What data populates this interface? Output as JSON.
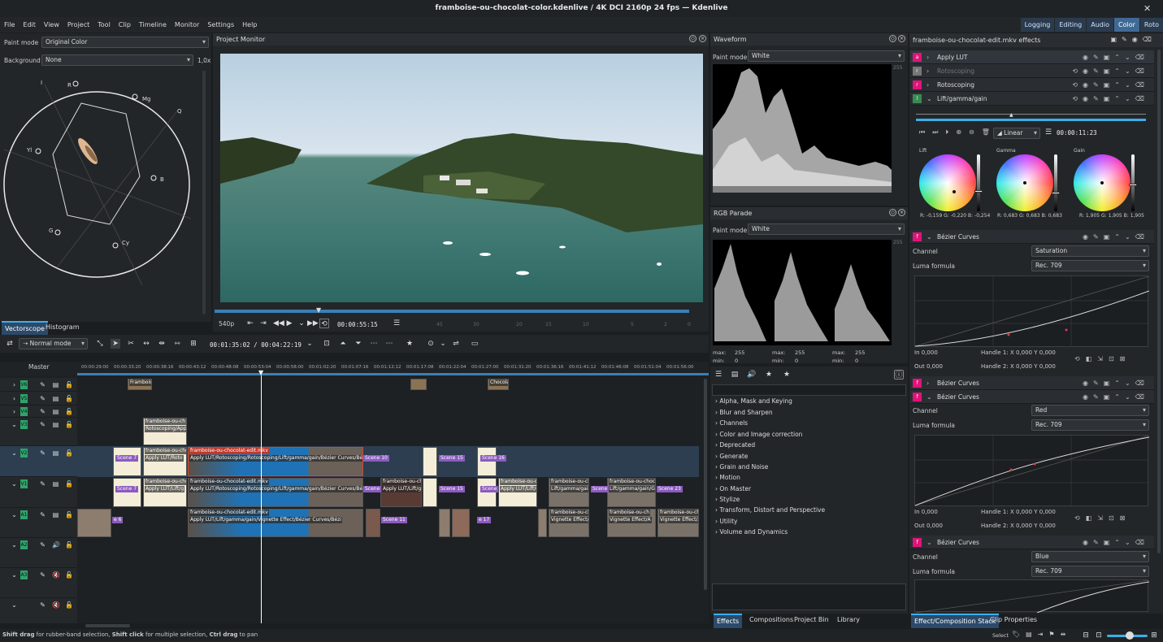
{
  "window": {
    "title": "framboise-ou-chocolat-color.kdenlive / 4K DCI 2160p 24 fps — Kdenlive",
    "close": "✕"
  },
  "menu": [
    "File",
    "Edit",
    "View",
    "Project",
    "Tool",
    "Clip",
    "Timeline",
    "Monitor",
    "Settings",
    "Help"
  ],
  "workspaces": [
    "Logging",
    "Editing",
    "Audio",
    "Color",
    "Roto"
  ],
  "vectorscope": {
    "paint_mode_label": "Paint mode",
    "paint_mode_value": "Original Color",
    "background_label": "Background",
    "background_value": "None",
    "zoom": "1,0x",
    "labels": {
      "r": "R",
      "mg": "Mg",
      "b": "B",
      "cy": "Cy",
      "g": "G",
      "yl": "Yl",
      "i": "I",
      "q": "Q"
    },
    "tabs": [
      "Vectorscope",
      "Histogram"
    ]
  },
  "project_monitor": {
    "title": "Project Monitor",
    "resolution": "540p",
    "timecode": "00:00:55:15",
    "ruler": [
      "45",
      "30",
      "20",
      "15",
      "10",
      "5",
      "2",
      "0"
    ]
  },
  "waveform": {
    "title": "Waveform",
    "paint_mode_label": "Paint mode",
    "paint_mode_value": "White",
    "top_value": "255"
  },
  "rgb_parade": {
    "title": "RGB Parade",
    "paint_mode_label": "Paint mode",
    "paint_mode_value": "White",
    "top_value": "255",
    "max_label": "max:",
    "min_label": "min:",
    "max_value": "255",
    "min_value": "0"
  },
  "timeline": {
    "mode": "Normal mode",
    "position": "00:01:35:02",
    "duration": "00:04:22:19",
    "master": "Master",
    "ruler": [
      "00:00:29:00",
      "00:00:33:20",
      "00:00:38:16",
      "00:00:43:12",
      "00:00:48:08",
      "00:00:53:04",
      "00:00:58:00",
      "00:01:02:20",
      "00:01:07:16",
      "00:01:12:12",
      "00:01:17:08",
      "00:01:22:04",
      "00:01:27:00",
      "00:01:31:20",
      "00:01:36:16",
      "00:01:41:12",
      "00:01:46:08",
      "00:01:51:04",
      "00:01:56:00"
    ],
    "tracks": [
      "V6",
      "V5",
      "V4",
      "V3",
      "V2",
      "V1",
      "A1",
      "A2",
      "A3"
    ],
    "clips": {
      "fr": "Framboise",
      "ch": "Chocolat",
      "v3a": "framboise-ou-ch",
      "v3b": "Rotoscoping/Appl",
      "v2a": "framboise-ou-chocolat-edit.mkv",
      "v2b": "Apply LUT/Roto",
      "v2c": "Apply LUT/Rotoscoping/Rotoscoping/Lift/gamma/gain/Bézier Curves/Bézi",
      "v1a": "framboise-ou-chocolat-edit.mkv",
      "v1b": "Apply LUT/Lift/g",
      "v1c": "Apply LUT/Rotoscoping/Rotoscoping/Lift/gamma/gain/Bézier Curves/Bézi",
      "v1d": "framboise-ou-chocolat",
      "v1e": "Apply LUT/Lift/g",
      "v1f": "framboise-ou-chocol",
      "v1g": "Apply LUT/Lift/g",
      "v1h": "framboise-ou-choco",
      "v1i": "Lift/gamma/gain",
      "v1j": "framboise-ou-choco",
      "v1k": "Lift/gamma/gain/Gri",
      "a1a": "framboise-ou-chocolat-edit.mkv",
      "a1b": "Apply LUT/Lift/gamma/gain/Vignette Effect/Bézier Curves/Bézi",
      "a1c": "framboise-ou-cho",
      "a1d": "Vignette Effect/A",
      "a1e": "framboise-ou-ch",
      "a1f": "Vignette Effect/A",
      "a1g": "framboise-ou-ch",
      "a1h": "Vignette Effect/A",
      "r1": "Roto",
      "scene": "Scenes"
    },
    "markers": {
      "s7": "Scene 7",
      "s10": "Scene 10",
      "s15": "Scene 15",
      "s16": "Scene 16",
      "s23": "Scene 23",
      "s6": "e 6",
      "s11": "Scene 11",
      "s17": "e 17",
      "sc": "Scene"
    }
  },
  "effects_stack": {
    "title": "framboise-ou-chocolat-edit.mkv effects",
    "items": [
      {
        "name": "Apply LUT",
        "color": "#e0147a",
        "letter": "a"
      },
      {
        "name": "Rotoscoping",
        "color": "#777777",
        "letter": "r"
      },
      {
        "name": "Rotoscoping",
        "color": "#e0147a",
        "letter": "r"
      },
      {
        "name": "Lift/gamma/gain",
        "color": "#3a8a54",
        "letter": "l"
      }
    ],
    "interp": "Linear",
    "kf_time": "00:00:11:23",
    "lgg": {
      "lift": "Lift",
      "gamma": "Gamma",
      "gain": "Gain",
      "lift_vals": "R: -0,159   G: -0,220   B: -0,254",
      "gamma_vals": "R: 0,683   G: 0,683   B: 0,683",
      "gain_vals": "R: 1,905   G: 1,905   B: 1,905"
    },
    "bezier": "Bézier Curves",
    "channel_label": "Channel",
    "luma_label": "Luma formula",
    "luma_value": "Rec. 709",
    "ch1": "Saturation",
    "ch2": "Red",
    "ch3": "Blue",
    "in_label": "In",
    "out_label": "Out",
    "zero": "0,000",
    "h1": "Handle 1:",
    "h2": "Handle 2:",
    "x": "X",
    "y": "Y"
  },
  "effects_panel": {
    "categories": [
      "Alpha, Mask and Keying",
      "Blur and Sharpen",
      "Channels",
      "Color and Image correction",
      "Deprecated",
      "Generate",
      "Grain and Noise",
      "Motion",
      "On Master",
      "Stylize",
      "Transform, Distort and Perspective",
      "Utility",
      "Volume and Dynamics"
    ],
    "tabs": [
      "Effects",
      "Compositions",
      "Project Bin",
      "Library"
    ]
  },
  "right_tabs": [
    "Effect/Composition Stack",
    "Clip Properties"
  ],
  "status": {
    "text1": "Shift drag",
    "text2": " for rubber-band selection, ",
    "text3": "Shift click",
    "text4": " for multiple selection, ",
    "text5": "Ctrl drag",
    "text6": " to pan",
    "select": "Select"
  }
}
